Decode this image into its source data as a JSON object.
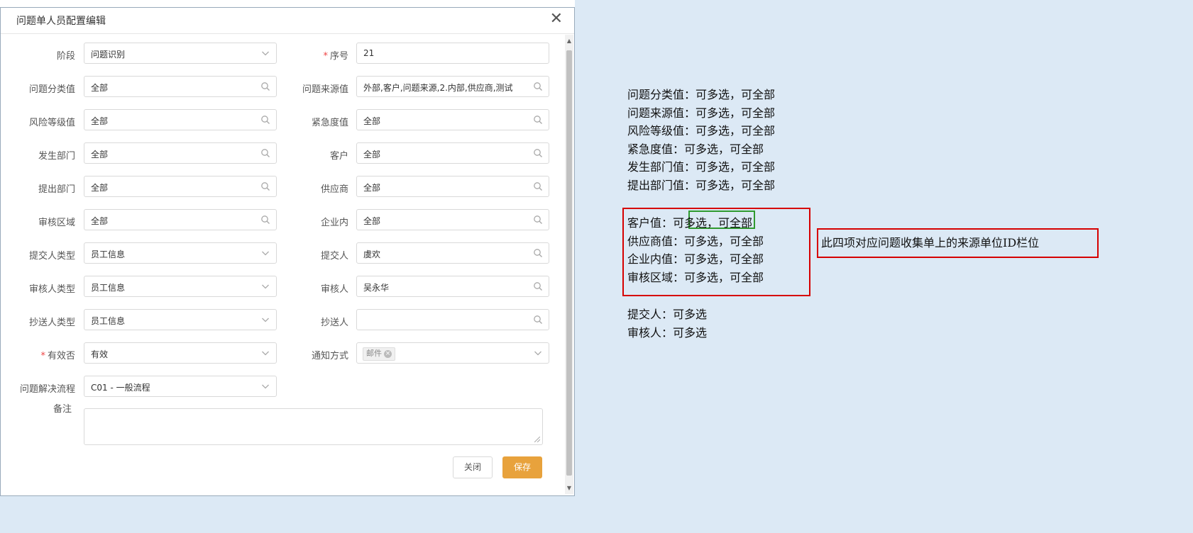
{
  "dialog": {
    "title": "问题单人员配置编辑",
    "close_glyph": "✕",
    "rows": [
      {
        "left": {
          "label": "阶段",
          "value": "问题识别",
          "icon": "chevron-down",
          "required": false
        },
        "right": {
          "label": "序号",
          "value": "21",
          "icon": "none",
          "required": true
        }
      },
      {
        "left": {
          "label": "问题分类值",
          "value": "全部",
          "icon": "search",
          "required": false
        },
        "right": {
          "label": "问题来源值",
          "value": "外部,客户,问题来源,2.内部,供应商,测试",
          "icon": "search",
          "required": false
        }
      },
      {
        "left": {
          "label": "风险等级值",
          "value": "全部",
          "icon": "search",
          "required": false
        },
        "right": {
          "label": "紧急度值",
          "value": "全部",
          "icon": "search",
          "required": false
        }
      },
      {
        "left": {
          "label": "发生部门",
          "value": "全部",
          "icon": "search",
          "required": false
        },
        "right": {
          "label": "客户",
          "value": "全部",
          "icon": "search",
          "required": false
        }
      },
      {
        "left": {
          "label": "提出部门",
          "value": "全部",
          "icon": "search",
          "required": false
        },
        "right": {
          "label": "供应商",
          "value": "全部",
          "icon": "search",
          "required": false
        }
      },
      {
        "left": {
          "label": "审核区域",
          "value": "全部",
          "icon": "search",
          "required": false
        },
        "right": {
          "label": "企业内",
          "value": "全部",
          "icon": "search",
          "required": false
        }
      },
      {
        "left": {
          "label": "提交人类型",
          "value": "员工信息",
          "icon": "chevron-down",
          "required": false
        },
        "right": {
          "label": "提交人",
          "value": "虞欢",
          "icon": "search",
          "required": false
        }
      },
      {
        "left": {
          "label": "审核人类型",
          "value": "员工信息",
          "icon": "chevron-down",
          "required": false
        },
        "right": {
          "label": "审核人",
          "value": "吴永华",
          "icon": "search",
          "required": false
        }
      },
      {
        "left": {
          "label": "抄送人类型",
          "value": "员工信息",
          "icon": "chevron-down",
          "required": false
        },
        "right": {
          "label": "抄送人",
          "value": "",
          "icon": "search",
          "required": false
        }
      },
      {
        "left": {
          "label": "有效否",
          "value": "有效",
          "icon": "chevron-down",
          "required": true
        },
        "right": {
          "label": "通知方式",
          "value": "",
          "tag": "邮件",
          "icon": "chevron-down",
          "required": false
        }
      },
      {
        "left": {
          "label": "问题解决流程",
          "value": "C01 - 一般流程",
          "icon": "chevron-down",
          "required": false
        }
      }
    ],
    "remark_label": "备注",
    "required_mark": "*",
    "tag_close": "×",
    "buttons": {
      "close": "关闭",
      "save": "保存"
    }
  },
  "annotations": {
    "group1": [
      "问题分类值：可多选，可全部",
      "问题来源值：可多选，可全部",
      "风险等级值：可多选，可全部",
      "紧急度值：可多选，可全部",
      "发生部门值：可多选，可全部",
      "提出部门值：可多选，可全部"
    ],
    "group2": [
      "客户值：可多选，可全部",
      "供应商值：可多选，可全部",
      "企业内值：可多选，可全部",
      "审核区域：可多选，可全部"
    ],
    "group2_note": "此四项对应问题收集单上的来源单位ID栏位",
    "group3": [
      "提交人：可多选",
      "审核人：可多选"
    ]
  },
  "colors": {
    "background": "#dce9f5",
    "accent": "#e8a23c",
    "highlight_red": "#d60000",
    "highlight_green": "#2f9a2f"
  }
}
